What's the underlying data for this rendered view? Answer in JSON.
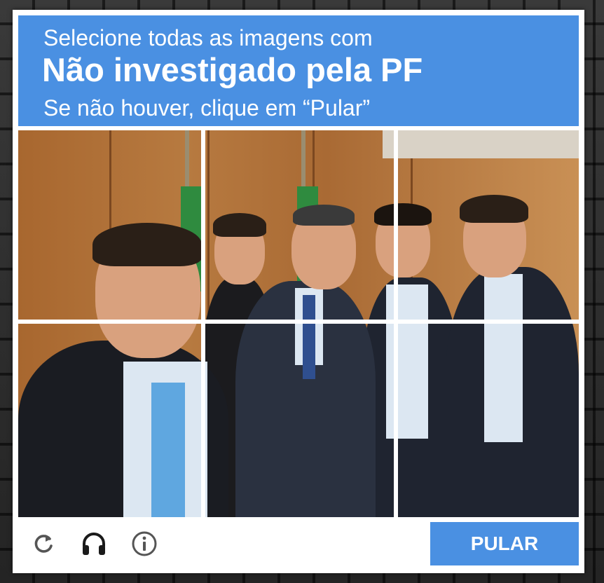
{
  "header": {
    "instruction": "Selecione todas as imagens com",
    "target": "Não investigado pela PF",
    "hint": "Se não houver, clique em “Pular”"
  },
  "grid": {
    "rows": 2,
    "cols": 3,
    "image_description_icon": "group-photo-image"
  },
  "footer": {
    "icons": [
      "reload-icon",
      "headphones-icon",
      "info-icon"
    ],
    "skip_label": "PULAR"
  },
  "colors": {
    "accent": "#4a90e2",
    "card": "#ffffff",
    "icon": "#555555"
  }
}
